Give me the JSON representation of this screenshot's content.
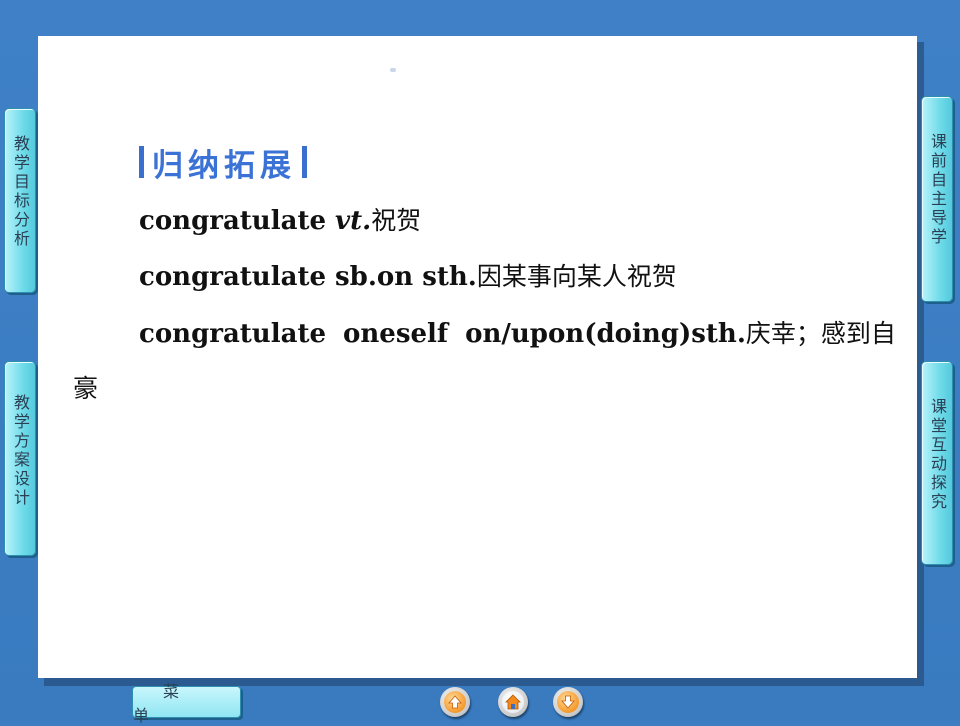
{
  "side_nav": {
    "left": [
      {
        "label": "教学目标分析"
      },
      {
        "label": "教学方案设计"
      }
    ],
    "right": [
      {
        "label": "课前自主导学"
      },
      {
        "label": "课堂互动探究"
      }
    ]
  },
  "content": {
    "heading": "归纳拓展",
    "lines": [
      {
        "en": "congratulate ",
        "em": "vt.",
        "cn": "祝贺"
      },
      {
        "en": "congratulate sb.on sth.",
        "cn": "因某事向某人祝贺"
      },
      {
        "en": "congratulate oneself on/upon(doing)sth.",
        "cn": "庆幸；感到自",
        "cn_cont": "豪"
      }
    ]
  },
  "bottom_bar": {
    "menu_label": "菜单",
    "nav_buttons": [
      {
        "icon": "arrow-up-icon"
      },
      {
        "icon": "home-icon"
      },
      {
        "icon": "arrow-down-icon"
      }
    ]
  },
  "colors": {
    "background": "#3d7ec3",
    "tab": "#6fdbe9",
    "heading": "#3a72d6"
  }
}
